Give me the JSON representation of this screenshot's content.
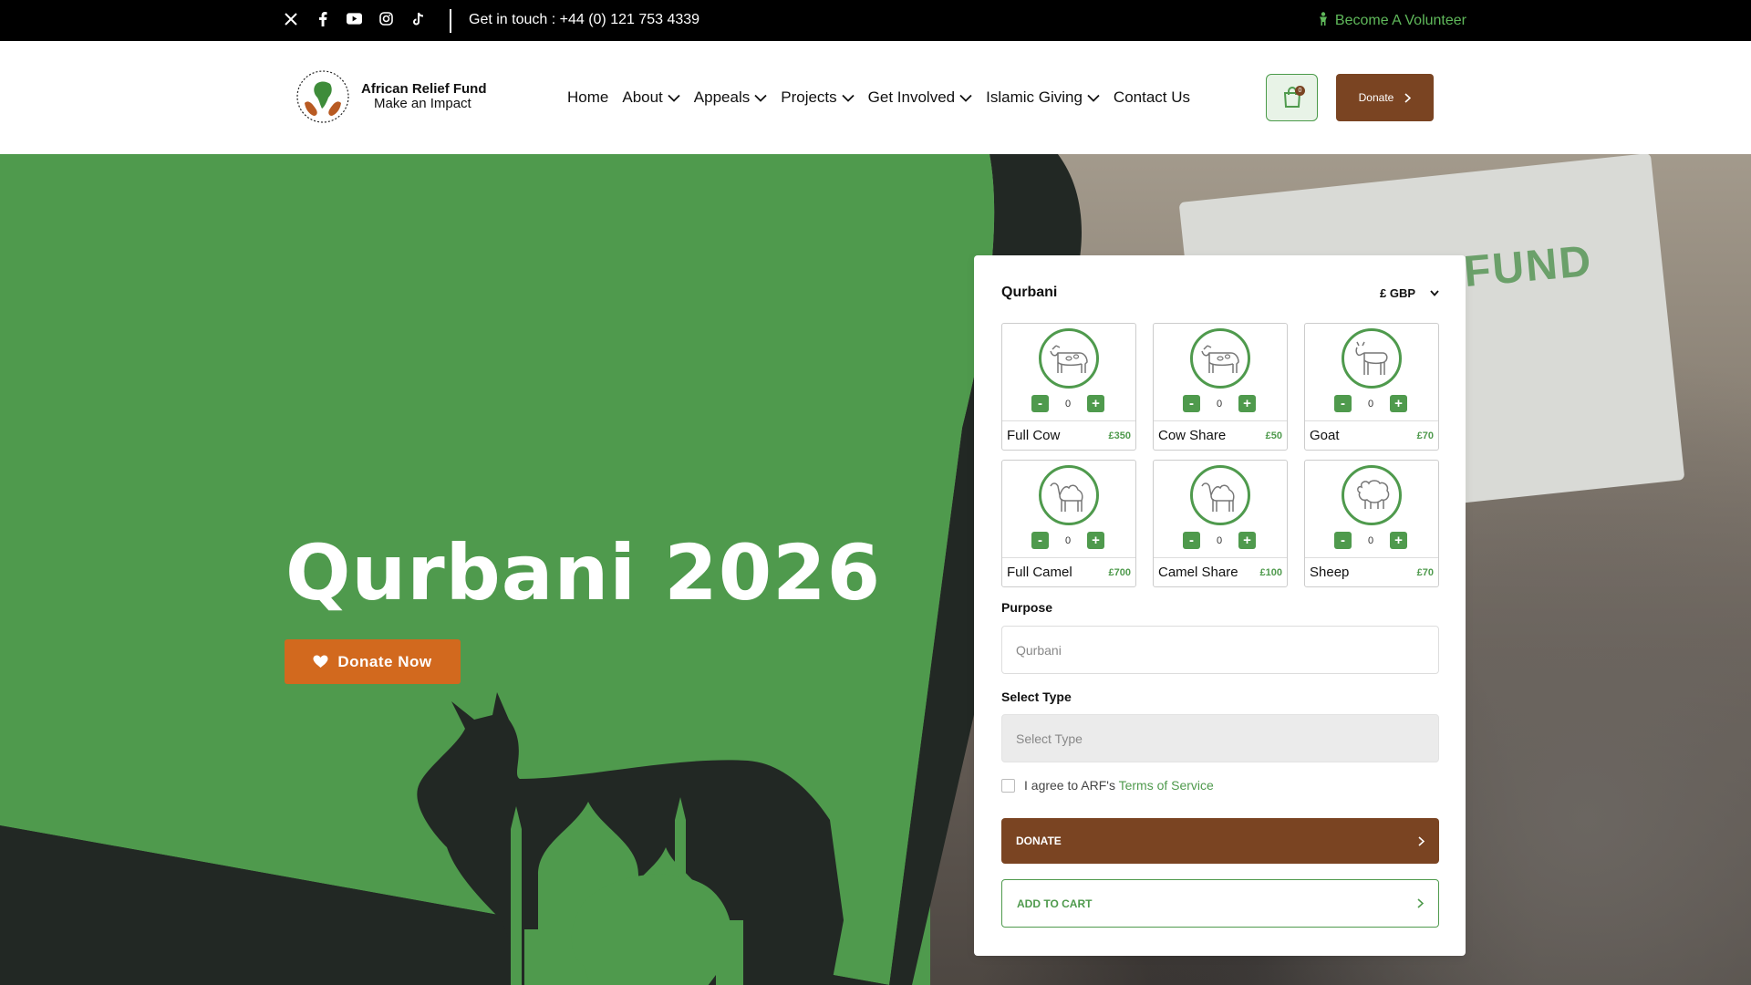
{
  "topbar": {
    "social_icons": [
      "x-icon",
      "facebook-icon",
      "youtube-icon",
      "instagram-icon",
      "tiktok-icon"
    ],
    "contact": "Get in touch : +44 (0) 121 753 4339",
    "volunteer": "Become A Volunteer"
  },
  "logo": {
    "name": "African Relief Fund",
    "tagline": "Make an Impact"
  },
  "nav": [
    {
      "label": "Home",
      "dropdown": false
    },
    {
      "label": "About",
      "dropdown": true
    },
    {
      "label": "Appeals",
      "dropdown": true
    },
    {
      "label": "Projects",
      "dropdown": true
    },
    {
      "label": "Get Involved",
      "dropdown": true
    },
    {
      "label": "Islamic Giving",
      "dropdown": true
    },
    {
      "label": "Contact Us",
      "dropdown": false
    }
  ],
  "cart": {
    "count": "0"
  },
  "header_donate": "Donate",
  "hero": {
    "title": "Qurbani 2026",
    "button": "Donate Now",
    "bag_text": "FUND"
  },
  "form": {
    "title": "Qurbani",
    "currency": "£ GBP",
    "animals": [
      {
        "name": "Full Cow",
        "price": "£350",
        "qty": "0",
        "icon": "cow-icon"
      },
      {
        "name": "Cow Share",
        "price": "£50",
        "qty": "0",
        "icon": "cow-icon"
      },
      {
        "name": "Goat",
        "price": "£70",
        "qty": "0",
        "icon": "goat-icon"
      },
      {
        "name": "Full Camel",
        "price": "£700",
        "qty": "0",
        "icon": "camel-icon"
      },
      {
        "name": "Camel Share",
        "price": "£100",
        "qty": "0",
        "icon": "camel-icon"
      },
      {
        "name": "Sheep",
        "price": "£70",
        "qty": "0",
        "icon": "sheep-icon"
      }
    ],
    "minus": "-",
    "plus": "+",
    "purpose_label": "Purpose",
    "purpose_value": "Qurbani",
    "type_label": "Select Type",
    "type_placeholder": "Select Type",
    "agree_text": "I agree to ARF's ",
    "agree_link": "Terms of Service",
    "donate_button": "DONATE",
    "cart_button": "ADD TO CART"
  },
  "colors": {
    "green": "#4f9a4d",
    "brown": "#7a4422",
    "orange": "#d2691e",
    "dark": "#222824"
  }
}
